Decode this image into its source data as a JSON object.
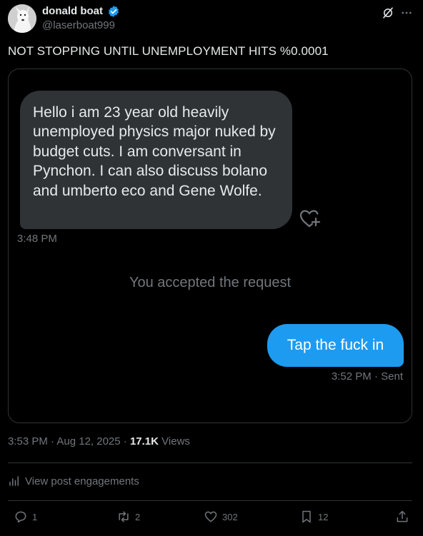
{
  "author": {
    "display_name": "donald boat",
    "handle": "@laserboat999"
  },
  "post": {
    "text": "NOT STOPPING UNTIL UNEMPLOYMENT HITS %0.0001"
  },
  "dm": {
    "incoming_message": "Hello i am 23 year old heavily unemployed physics major nuked by budget cuts. I am conversant in Pynchon. I can also discuss bolano and umberto eco and Gene Wolfe.",
    "incoming_time": "3:48 PM",
    "system_note": "You accepted the request",
    "outgoing_message": "Tap the fuck in",
    "outgoing_time": "3:52 PM",
    "outgoing_status": "· Sent"
  },
  "meta": {
    "timestamp": "3:53 PM · Aug 12, 2025 ·",
    "views_count": "17.1K",
    "views_label": "Views"
  },
  "engagements_link": "View post engagements",
  "actions": {
    "replies": "1",
    "reposts": "2",
    "likes": "302",
    "bookmarks": "12"
  },
  "colors": {
    "background": "#000000",
    "accent_blue": "#1d9bf0",
    "incoming_bubble": "#2f3336",
    "muted_text": "#71767b",
    "primary_text": "#e7e9ea"
  },
  "icons": [
    "verified-badge-icon",
    "grok-icon",
    "more-icon",
    "heart-add-icon",
    "analytics-icon",
    "reply-icon",
    "repost-icon",
    "like-icon",
    "bookmark-icon",
    "share-icon"
  ]
}
